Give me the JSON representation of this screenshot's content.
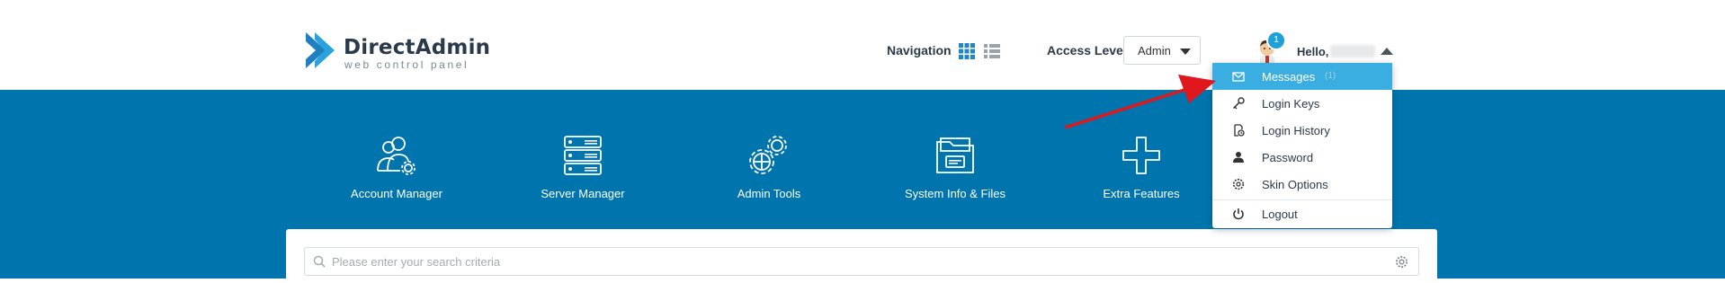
{
  "brand": {
    "title": "DirectAdmin",
    "subtitle": "web control panel"
  },
  "header": {
    "navigation_label": "Navigation",
    "access_level_label": "Access Level",
    "access_level_value": "Admin",
    "notification_count": "1",
    "greeting": "Hello,"
  },
  "categories": [
    {
      "label": "Account Manager",
      "icon": "account-manager-icon"
    },
    {
      "label": "Server Manager",
      "icon": "server-manager-icon"
    },
    {
      "label": "Admin Tools",
      "icon": "admin-tools-icon"
    },
    {
      "label": "System Info & Files",
      "icon": "system-info-files-icon"
    },
    {
      "label": "Extra Features",
      "icon": "extra-features-icon"
    }
  ],
  "search": {
    "placeholder": "Please enter your search criteria"
  },
  "user_menu": {
    "items": [
      {
        "label": "Messages",
        "icon": "envelope-icon",
        "count": "(1)"
      },
      {
        "label": "Login Keys",
        "icon": "key-icon"
      },
      {
        "label": "Login History",
        "icon": "login-history-icon"
      },
      {
        "label": "Password",
        "icon": "user-icon"
      },
      {
        "label": "Skin Options",
        "icon": "gear-icon"
      },
      {
        "label": "Logout",
        "icon": "power-icon"
      }
    ]
  },
  "colors": {
    "brand_blue": "#0075ad",
    "menu_active": "#3aaee0",
    "badge": "#1ea0d8",
    "annotation_arrow": "#e0171c"
  }
}
